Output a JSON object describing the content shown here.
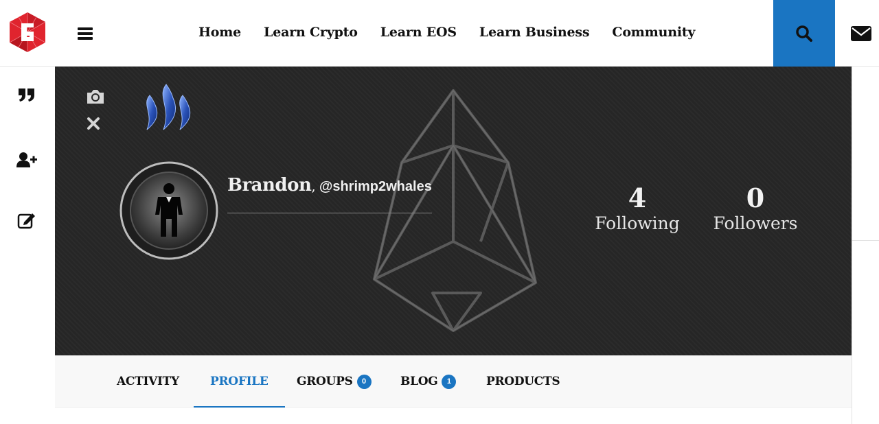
{
  "header": {
    "nav": [
      "Home",
      "Learn Crypto",
      "Learn EOS",
      "Learn Business",
      "Community"
    ],
    "accent_color": "#1a75c2",
    "icons": {
      "logo": "site-logo",
      "menu": "hamburger-icon",
      "search": "search-icon",
      "mail": "envelope-icon"
    }
  },
  "sidebar": {
    "icons": [
      "quote-icon",
      "add-user-icon",
      "edit-icon"
    ]
  },
  "profile": {
    "name": "Brandon",
    "separator": ",",
    "handle": "@shrimp2whales",
    "stats": [
      {
        "value": "4",
        "label": "Following"
      },
      {
        "value": "0",
        "label": "Followers"
      }
    ]
  },
  "tabs": [
    {
      "label": "ACTIVITY",
      "active": false
    },
    {
      "label": "PROFILE",
      "active": true
    },
    {
      "label": "GROUPS",
      "badge": "0",
      "active": false
    },
    {
      "label": "BLOG",
      "badge": "1",
      "active": false
    },
    {
      "label": "PRODUCTS",
      "active": false
    }
  ]
}
